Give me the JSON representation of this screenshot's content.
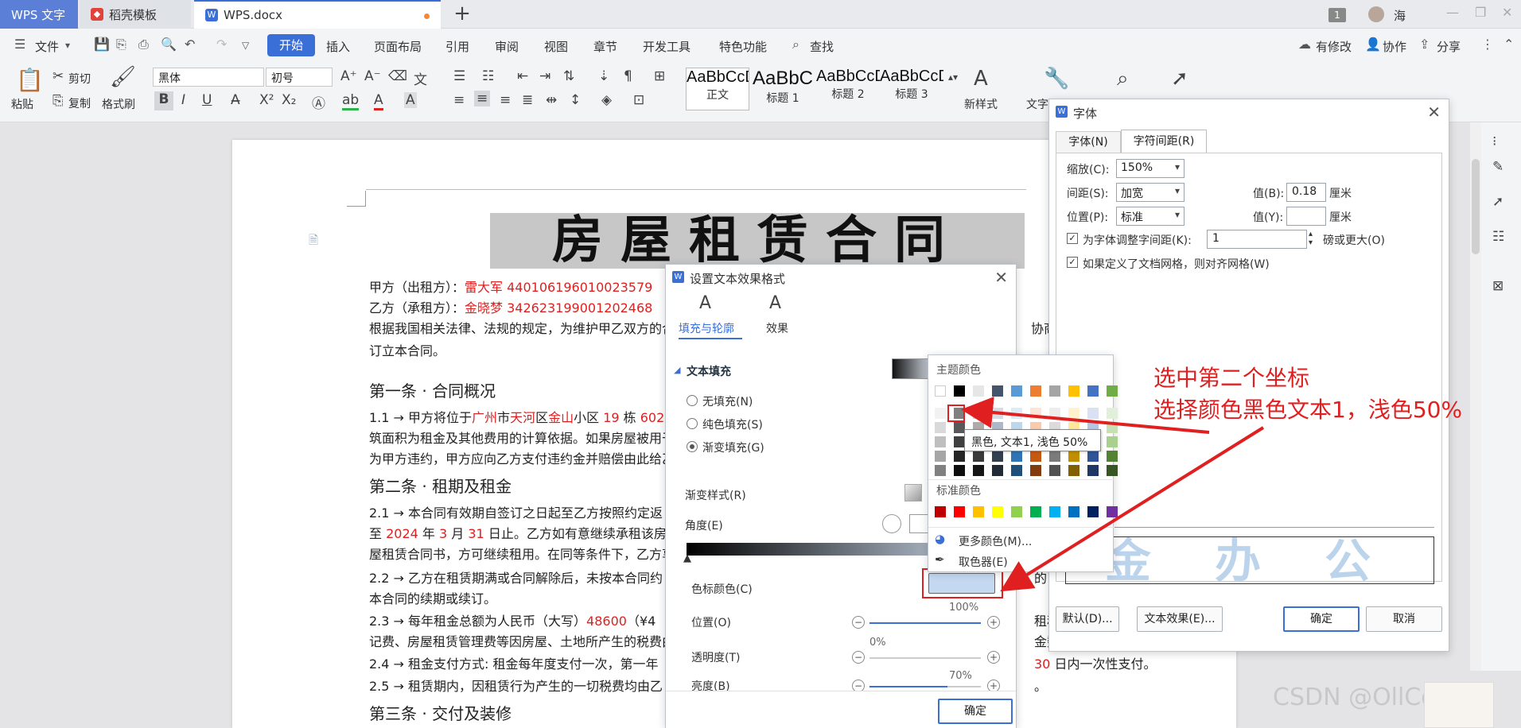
{
  "titlebar": {
    "app_tab": "WPS 文字",
    "template_tab": "稻壳模板",
    "doc_tab": "WPS.docx",
    "window_count": "1",
    "user": "海"
  },
  "menu": {
    "file": "文件",
    "tabs": [
      "开始",
      "插入",
      "页面布局",
      "引用",
      "审阅",
      "视图",
      "章节",
      "开发工具",
      "特色功能"
    ],
    "search": "查找",
    "right": [
      "有修改",
      "协作",
      "分享"
    ]
  },
  "ribbon": {
    "paste": "粘贴",
    "cut": "剪切",
    "copy": "复制",
    "format_painter": "格式刷",
    "font_name": "黑体",
    "font_size": "初号",
    "styles": [
      {
        "preview": "AaBbCcD",
        "name": "正文"
      },
      {
        "preview": "AaBbC",
        "name": "标题 1"
      },
      {
        "preview": "AaBbCcD",
        "name": "标题 2"
      },
      {
        "preview": "AaBbCcD",
        "name": "标题 3"
      }
    ],
    "new_style": "新样式",
    "text_tools": "文字"
  },
  "doc": {
    "title": "房屋租赁合同",
    "party_a_label": "甲方（出租方）：",
    "party_a_value": "雷大军 440106196010023579",
    "party_b_label": "乙方（承租方）：",
    "party_b_value": "金晓梦 342623199001202468",
    "intro": "根据我国相关法律、法规的规定，为维护甲乙双方的合",
    "intro_tail": "协商，",
    "intro2": "订立本合同。",
    "art1": "第一条 · 合同概况",
    "p11_a": "1.1 → 甲方将位于",
    "p11_city": "广州",
    "p11_b": "市",
    "p11_district": "天河",
    "p11_c": "区",
    "p11_area": "金山",
    "p11_d": "小区 ",
    "p11_bld": "19",
    "p11_e": " 栋 ",
    "p11_room": "602",
    "p11_line2": "筑面积为租金及其他费用的计算依据。如果房屋被用于",
    "p11_line3": "为甲方违约，甲方应向乙方支付违约金并赔偿由此给乙",
    "art2": "第二条 · 租期及租金",
    "p21": "2.1 → 本合同有效期自签订之日起至乙方按照约定返",
    "p21_line2_a": "至 ",
    "p21_year": "2024",
    "p21_line2_b": " 年 ",
    "p21_month": "3",
    "p21_line2_c": " 月 ",
    "p21_day": "31",
    "p21_line2_d": " 日止。乙方如有意继续承租该房屋",
    "p21_line3": "屋租赁合同书，方可继续租用。在同等条件下，乙方享",
    "p22": "2.2 → 乙方在租赁期满或合同解除后，未按本合同约",
    "p22_tail": "的，",
    "p22_line2": "本合同的续期或续订。",
    "p23_a": "2.3 → 每年租金总额为人民币（大写）",
    "p23_amount": "48600",
    "p23_b": "（¥4",
    "p23_tail": "租税、",
    "p23_line2": "记费、房屋租赁管理费等因房屋、土地所产生的税费由",
    "p23_line2_tail": "金数",
    "p24": "2.4 → 租金支付方式: 租金每年度支付一次，第一年",
    "p24_tail_num": "30",
    "p24_tail": " 日内一次性支付。",
    "p25": "2.5 → 租赁期内，因租赁行为产生的一切税费均由乙",
    "p25_tail": "。",
    "art3": "第三条 · 交付及装修"
  },
  "text_effect_dialog": {
    "title": "设置文本效果格式",
    "tab_fill": "填充与轮廓",
    "tab_effect": "效果",
    "section": "文本填充",
    "opt_none": "无填充(N)",
    "opt_solid": "纯色填充(S)",
    "opt_gradient": "渐变填充(G)",
    "gradient_style": "渐变样式(R)",
    "angle": "角度(E)",
    "stop_color": "色标颜色(C)",
    "position": "位置(O)",
    "position_value": "100%",
    "position_fraction": 1.0,
    "transparency": "透明度(T)",
    "transparency_value": "0%",
    "transparency_fraction": 0.0,
    "brightness": "亮度(B)",
    "brightness_value": "70%",
    "brightness_fraction": 0.7,
    "ok": "确定"
  },
  "color_picker": {
    "theme_title": "主题颜色",
    "tooltip": "黑色, 文本1, 浅色 50%",
    "standard_title": "标准颜色",
    "more": "更多颜色(M)...",
    "eyedropper": "取色器(E)",
    "theme_top": [
      "#ffffff",
      "#000000",
      "#e7e6e6",
      "#44546a",
      "#5b9bd5",
      "#ed7d31",
      "#a5a5a5",
      "#ffc000",
      "#4472c4",
      "#70ad47"
    ],
    "theme_shades": [
      [
        "#f2f2f2",
        "#808080",
        "#d0cece",
        "#d6dce4",
        "#ddebf7",
        "#fce4d6",
        "#ededed",
        "#fff2cc",
        "#d9e1f2",
        "#e2efda"
      ],
      [
        "#d9d9d9",
        "#595959",
        "#aeaaaa",
        "#adb9ca",
        "#bdd7ee",
        "#f8cbad",
        "#dbdbdb",
        "#ffe699",
        "#b4c6e7",
        "#c6e0b4"
      ],
      [
        "#bfbfbf",
        "#404040",
        "#757171",
        "#8497b0",
        "#9bc2e6",
        "#f4b084",
        "#c9c9c9",
        "#ffd966",
        "#8ea9db",
        "#a9d08e"
      ],
      [
        "#a6a6a6",
        "#262626",
        "#3a3838",
        "#333f4f",
        "#2f75b5",
        "#c65911",
        "#7b7b7b",
        "#bf8f00",
        "#305496",
        "#548235"
      ],
      [
        "#808080",
        "#0d0d0d",
        "#161616",
        "#222b35",
        "#1f4e78",
        "#833c0c",
        "#525252",
        "#806000",
        "#203764",
        "#375623"
      ]
    ],
    "standard": [
      "#c00000",
      "#ff0000",
      "#ffc000",
      "#ffff00",
      "#92d050",
      "#00b050",
      "#00b0f0",
      "#0070c0",
      "#002060",
      "#7030a0"
    ]
  },
  "font_dialog": {
    "title": "字体",
    "tab_font": "字体(N)",
    "tab_spacing": "字符间距(R)",
    "scale_label": "缩放(C):",
    "scale_value": "150%",
    "spacing_label": "间距(S):",
    "spacing_value": "加宽",
    "spacing_amount_label": "值(B):",
    "spacing_amount": "0.18",
    "unit": "厘米",
    "position_label": "位置(P):",
    "position_value": "标准",
    "position_amount_label": "值(Y):",
    "kerning_label": "为字体调整字间距(K):",
    "kerning_value": "1",
    "kerning_tail": "磅或更大(O)",
    "grid_label": "如果定义了文档网格，则对齐网格(W)",
    "preview_text": "金 办 公 更",
    "default_btn": "默认(D)...",
    "text_effect_btn": "文本效果(E)...",
    "ok": "确定",
    "cancel": "取消"
  },
  "annotation": {
    "line1": "选中第二个坐标",
    "line2": "选择颜色黑色文本1，浅色50%"
  },
  "watermark": "CSDN @OllCorrect"
}
